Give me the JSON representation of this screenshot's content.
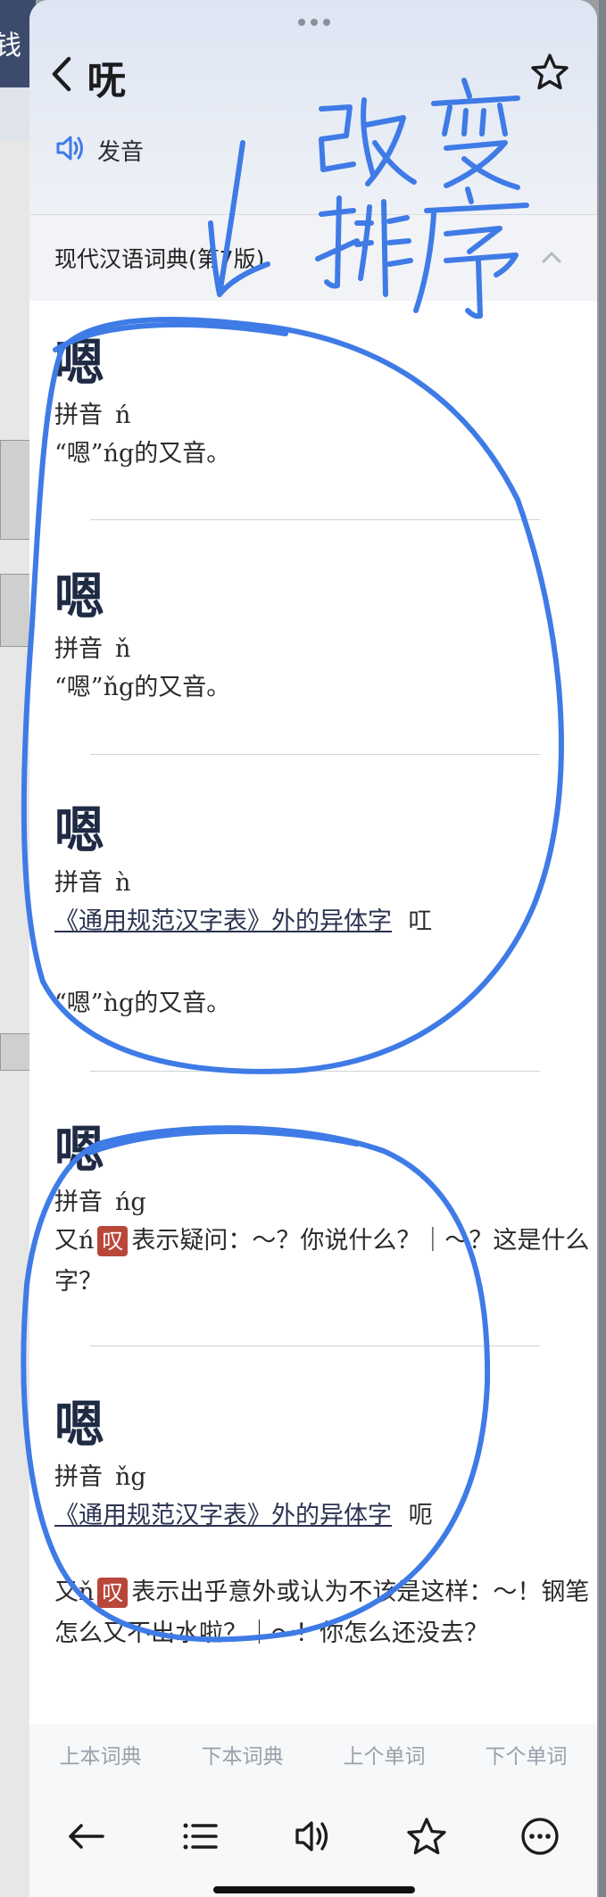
{
  "background": {
    "header_glyph": "钱"
  },
  "header": {
    "character": "呒",
    "pronounce_label": "发音"
  },
  "dictionary": {
    "title": "现代汉语词典(第7版)"
  },
  "entries": [
    {
      "character": "嗯",
      "pinyin_label": "拼音",
      "pinyin": "ń",
      "definition": "“嗯”ńg的又音。"
    },
    {
      "character": "嗯",
      "pinyin_label": "拼音",
      "pinyin": "ň",
      "definition": "“嗯”ňg的又音。"
    },
    {
      "character": "嗯",
      "pinyin_label": "拼音",
      "pinyin": "ǹ",
      "variant_link": "《通用规范汉字表》外的异体字",
      "variant_char": "叿",
      "definition": "“嗯”ǹg的又音。"
    },
    {
      "character": "嗯",
      "pinyin_label": "拼音",
      "pinyin": "ńg",
      "prefix": "又ń",
      "tag": "叹",
      "definition": "表示疑问：～？你说什么？｜～？这是什么字？"
    },
    {
      "character": "嗯",
      "pinyin_label": "拼音",
      "pinyin": "ňg",
      "variant_link": "《通用规范汉字表》外的异体字",
      "variant_char": "呃",
      "prefix": "又ň",
      "tag": "叹",
      "definition": "表示出乎意外或认为不该是这样：～！钢笔怎么又不出水啦？｜～！你怎么还没去？"
    }
  ],
  "nav": {
    "prev_dict": "上本词典",
    "next_dict": "下本词典",
    "prev_word": "上个单词",
    "next_word": "下个单词"
  },
  "toolbar": [
    "back-arrow-icon",
    "list-icon",
    "speaker-icon",
    "star-icon",
    "more-icon"
  ],
  "annotation": {
    "text": "改变排序",
    "color": "#3f7be6"
  },
  "colors": {
    "accent": "#3f7be6",
    "tag": "#b8473a"
  }
}
